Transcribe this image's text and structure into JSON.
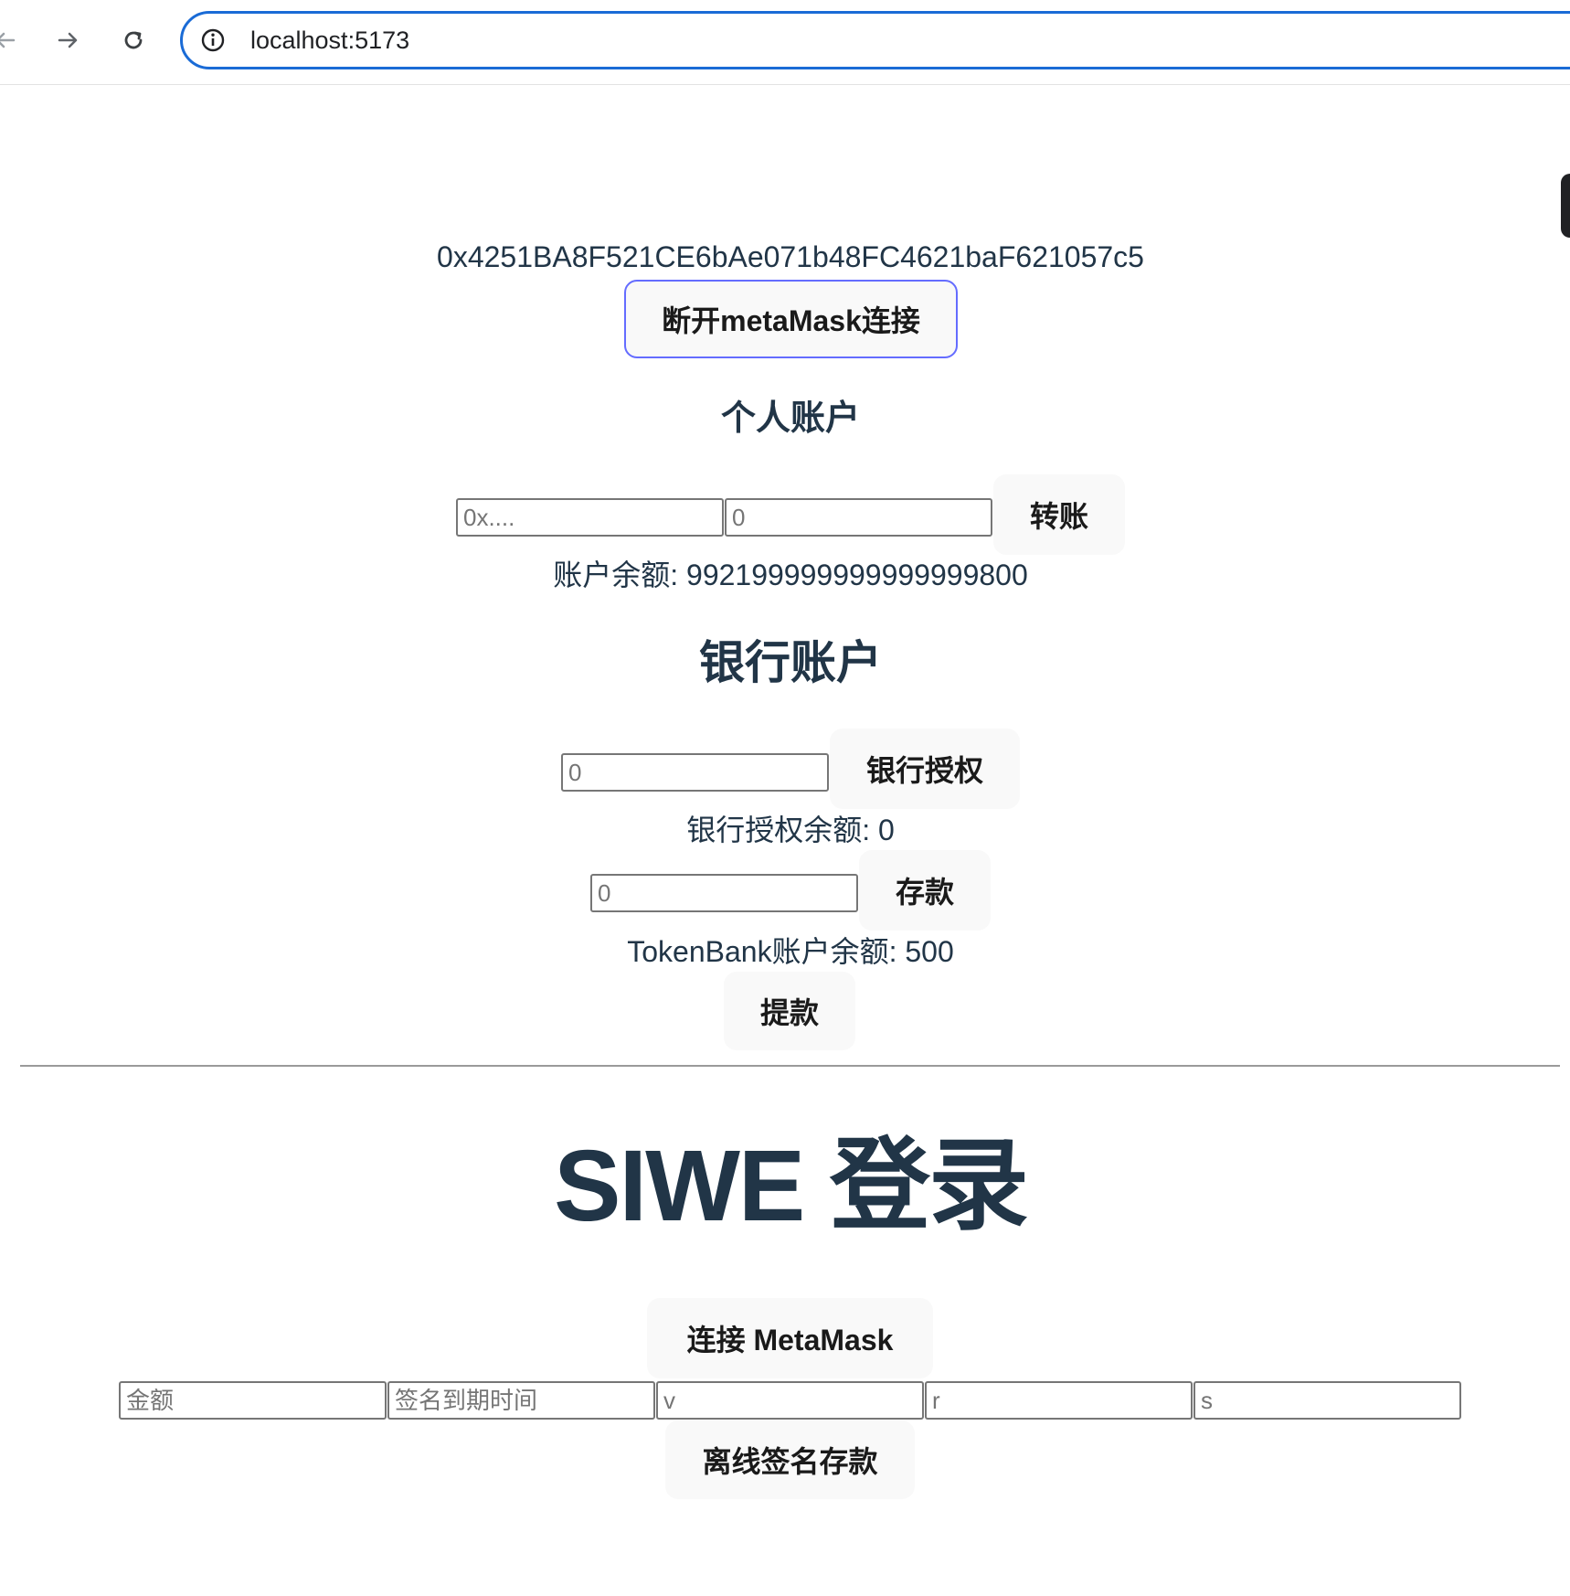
{
  "browser": {
    "url": "localhost:5173"
  },
  "wallet": {
    "address": "0x4251BA8F521CE6bAe071b48FC4621baF621057c5",
    "disconnect_label": "断开metaMask连接"
  },
  "personal": {
    "heading": "个人账户",
    "to_placeholder": "0x....",
    "amount_placeholder": "0",
    "transfer_label": "转账",
    "balance_text": "账户余额: 992199999999999999800"
  },
  "bank": {
    "heading": "银行账户",
    "approve_placeholder": "0",
    "approve_label": "银行授权",
    "allowance_text": "银行授权余额: 0",
    "deposit_placeholder": "0",
    "deposit_label": "存款",
    "bank_balance_text": "TokenBank账户余额: 500",
    "withdraw_label": "提款"
  },
  "siwe": {
    "heading": "SIWE 登录",
    "connect_label": "连接 MetaMask",
    "amount_placeholder": "金额",
    "deadline_placeholder": "签名到期时间",
    "v_placeholder": "v",
    "r_placeholder": "r",
    "s_placeholder": "s",
    "permit_deposit_label": "离线签名存款"
  }
}
